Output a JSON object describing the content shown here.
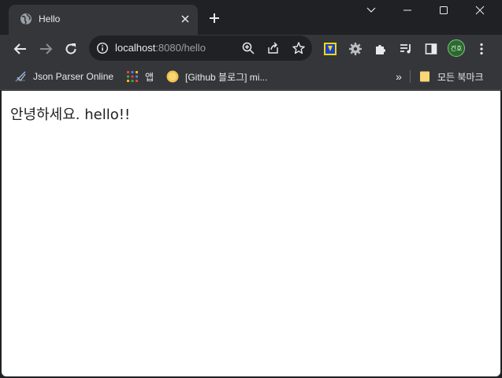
{
  "tab": {
    "title": "Hello",
    "favicon": "globe-icon"
  },
  "omnibox": {
    "host": "localhost",
    "path": ":8080/hello"
  },
  "profile": {
    "initials": "건호"
  },
  "bookmarks": [
    {
      "label": "Json Parser Online",
      "icon": "json-parser-icon"
    },
    {
      "label": "앱",
      "icon": "apps-grid-icon"
    },
    {
      "label": "[Github 블로그] mi...",
      "icon": "github-blog-icon"
    }
  ],
  "all_bookmarks": {
    "label": "모든 북마크",
    "icon": "folder-icon"
  },
  "page": {
    "text": "안녕하세요. hello!!"
  },
  "colors": {
    "frame": "#202124",
    "toolbar": "#35363a",
    "page_bg": "#ffffff"
  }
}
